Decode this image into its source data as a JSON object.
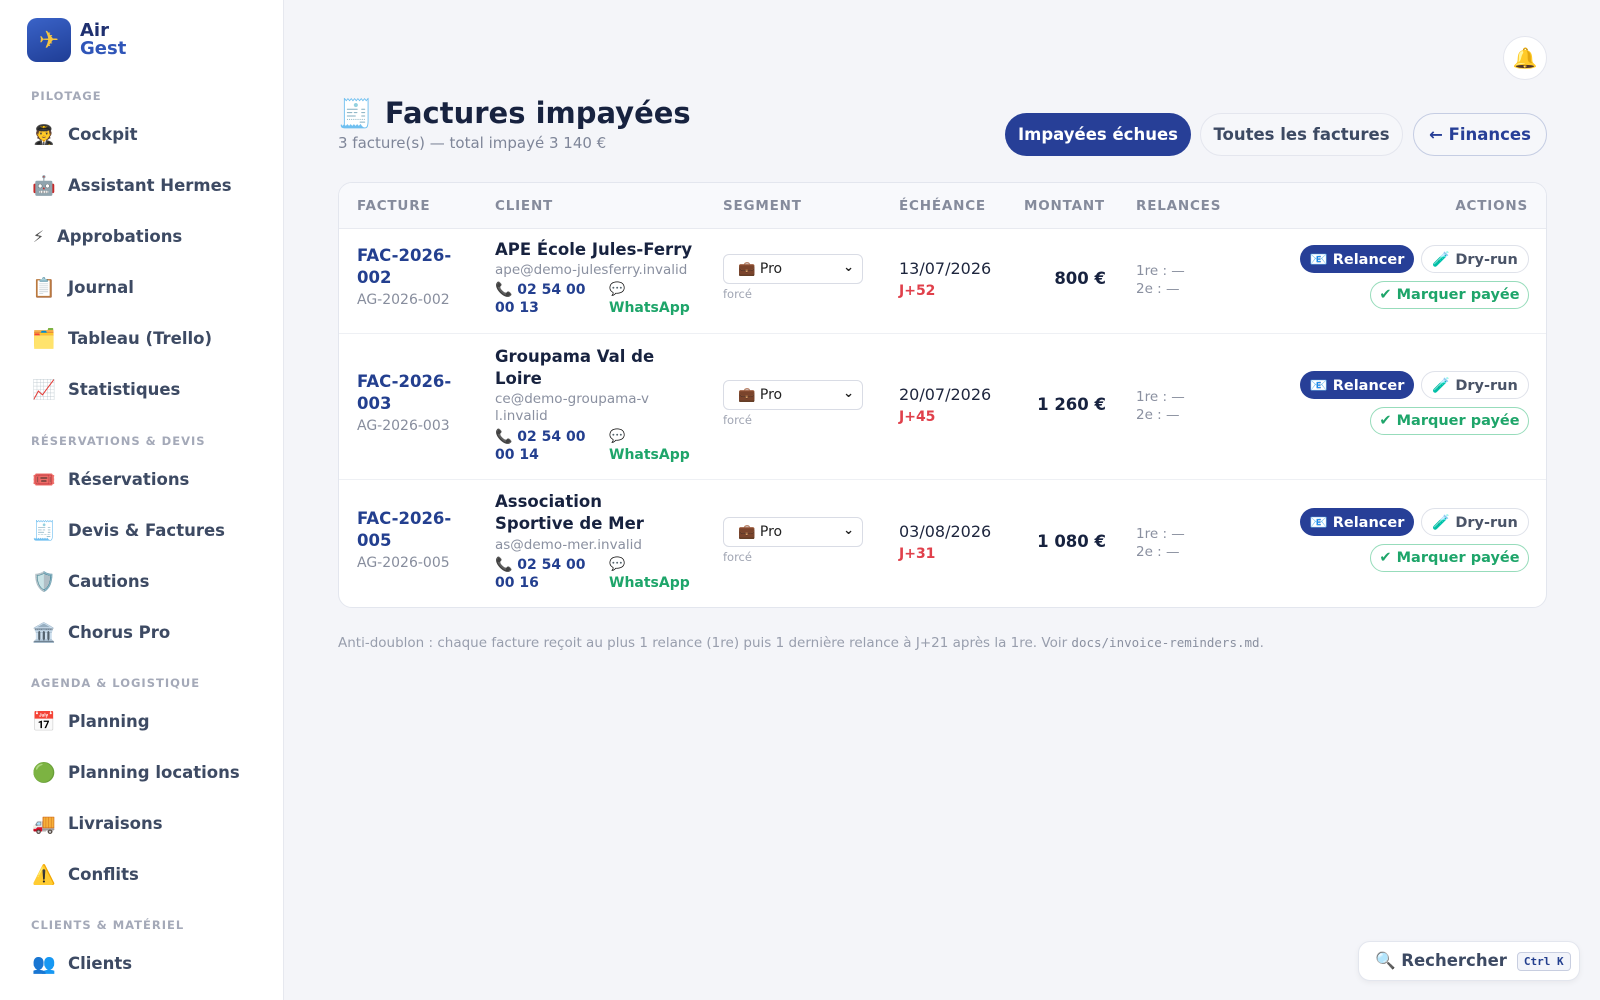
{
  "brand": {
    "logo": "✈",
    "line1": "Air",
    "line2": "Gest"
  },
  "sidebar": {
    "sections": [
      {
        "title": "PILOTAGE",
        "items": [
          {
            "icon": "🧑‍✈️",
            "label": "Cockpit"
          },
          {
            "icon": "🤖",
            "label": "Assistant Hermes"
          },
          {
            "icon": "⚡",
            "label": "Approbations"
          },
          {
            "icon": "📋",
            "label": "Journal"
          },
          {
            "icon": "🗂️",
            "label": "Tableau (Trello)"
          },
          {
            "icon": "📈",
            "label": "Statistiques"
          }
        ]
      },
      {
        "title": "RÉSERVATIONS & DEVIS",
        "items": [
          {
            "icon": "🎟️",
            "label": "Réservations"
          },
          {
            "icon": "🧾",
            "label": "Devis & Factures"
          },
          {
            "icon": "🛡️",
            "label": "Cautions"
          },
          {
            "icon": "🏛️",
            "label": "Chorus Pro"
          }
        ]
      },
      {
        "title": "AGENDA & LOGISTIQUE",
        "items": [
          {
            "icon": "📅",
            "label": "Planning"
          },
          {
            "icon": "🟢",
            "label": "Planning locations"
          },
          {
            "icon": "🚚",
            "label": "Livraisons"
          },
          {
            "icon": "⚠️",
            "label": "Conflits"
          }
        ]
      },
      {
        "title": "CLIENTS & MATÉRIEL",
        "items": [
          {
            "icon": "👥",
            "label": "Clients"
          }
        ]
      }
    ]
  },
  "header": {
    "icon": "🧾",
    "title": "Factures impayées",
    "subtitle": "3 facture(s) — total impayé 3 140 €",
    "bell": "🔔"
  },
  "filters": {
    "unpaid_due": "Impayées échues",
    "all": "Toutes les factures",
    "back": "← Finances"
  },
  "table": {
    "columns": [
      "FACTURE",
      "CLIENT",
      "SEGMENT",
      "ÉCHÉANCE",
      "MONTANT",
      "RELANCES",
      "ACTIONS"
    ],
    "rows": [
      {
        "invoice_line1": "FAC-2026-",
        "invoice_line2": "002",
        "ref": "AG-2026-002",
        "client": "APE École Jules-Ferry",
        "email": "ape@demo-julesferry.invalid",
        "phone_line1": "📞 02 54 00",
        "phone_line2": "00 13",
        "whatsapp_icon": "💬",
        "whatsapp": "WhatsApp",
        "segment": "💼 Pro",
        "segment_note": "forcé",
        "due": "13/07/2026",
        "delay": "J+52",
        "amount": "800 €",
        "rel1": "1re : —",
        "rel2": "2e : —"
      },
      {
        "invoice_line1": "FAC-2026-",
        "invoice_line2": "003",
        "ref": "AG-2026-003",
        "client": "Groupama Val de Loire",
        "email": "ce@demo-groupama-vl.invalid",
        "phone_line1": "📞 02 54 00",
        "phone_line2": "00 14",
        "whatsapp_icon": "💬",
        "whatsapp": "WhatsApp",
        "segment": "💼 Pro",
        "segment_note": "forcé",
        "due": "20/07/2026",
        "delay": "J+45",
        "amount": "1 260 €",
        "rel1": "1re : —",
        "rel2": "2e : —"
      },
      {
        "invoice_line1": "FAC-2026-",
        "invoice_line2": "005",
        "ref": "AG-2026-005",
        "client": "Association Sportive de Mer",
        "email": "as@demo-mer.invalid",
        "phone_line1": "📞 02 54 00",
        "phone_line2": "00 16",
        "whatsapp_icon": "💬",
        "whatsapp": "WhatsApp",
        "segment": "💼 Pro",
        "segment_note": "forcé",
        "due": "03/08/2026",
        "delay": "J+31",
        "amount": "1 080 €",
        "rel1": "1re : —",
        "rel2": "2e : —"
      }
    ],
    "actions": {
      "remind": "📧 Relancer",
      "dry_run": "🧪 Dry-run",
      "mark_paid": "✔ Marquer payée"
    }
  },
  "note": {
    "text": "Anti-doublon : chaque facture reçoit au plus 1 relance (1re) puis 1 dernière relance à J+21 après la 1re. Voir ",
    "code": "docs/invoice-reminders.md",
    "end": "."
  },
  "search": {
    "label": "🔍 Rechercher",
    "shortcut": "Ctrl K"
  },
  "colors": {
    "primary": "#273f97",
    "danger": "#e0404b",
    "success": "#1ea56a"
  }
}
